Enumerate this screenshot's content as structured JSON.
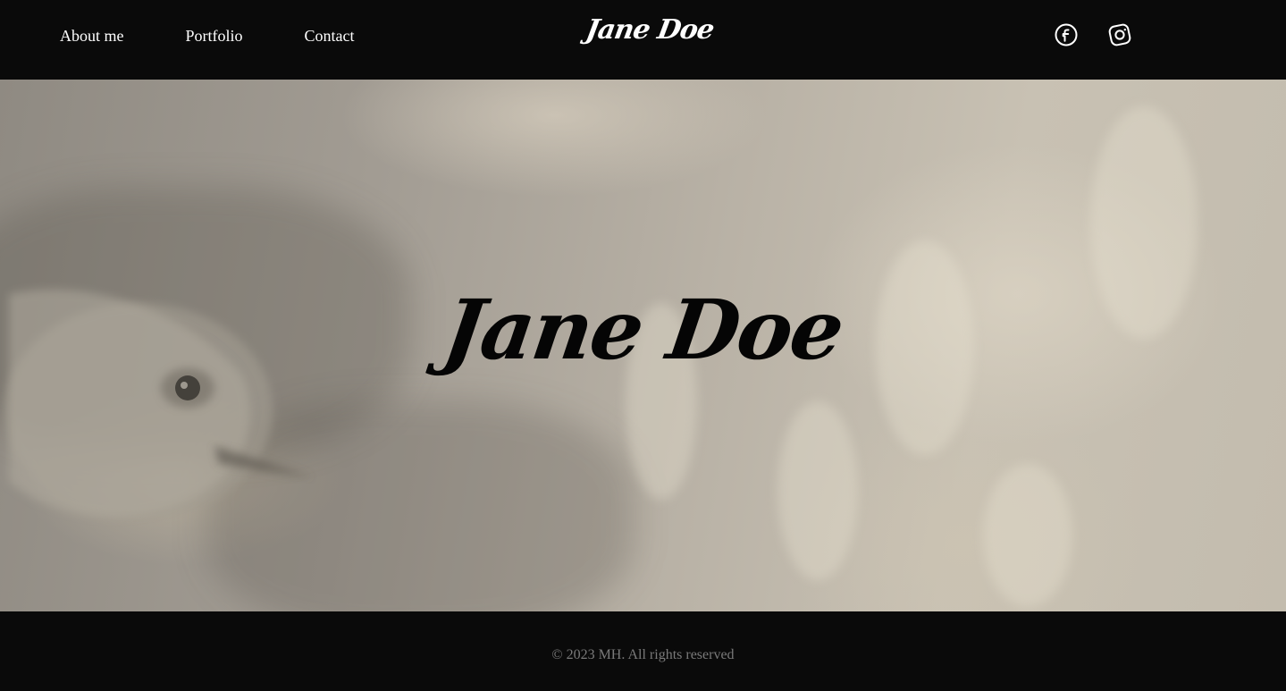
{
  "header": {
    "nav": {
      "about": "About me",
      "portfolio": "Portfolio",
      "contact": "Contact"
    },
    "brand": "Jane Doe",
    "social": {
      "facebook_icon": "facebook-icon",
      "instagram_icon": "instagram-icon"
    }
  },
  "hero": {
    "title": "Jane Doe",
    "background": "blurred sepia photo of a bird"
  },
  "footer": {
    "copyright": "© 2023 MH. All rights reserved"
  },
  "colors": {
    "header_bg": "#0a0a0a",
    "footer_bg": "#0a0a0a",
    "nav_text": "#ffffff",
    "footer_text": "#7a7a7a",
    "hero_title": "#050505"
  }
}
